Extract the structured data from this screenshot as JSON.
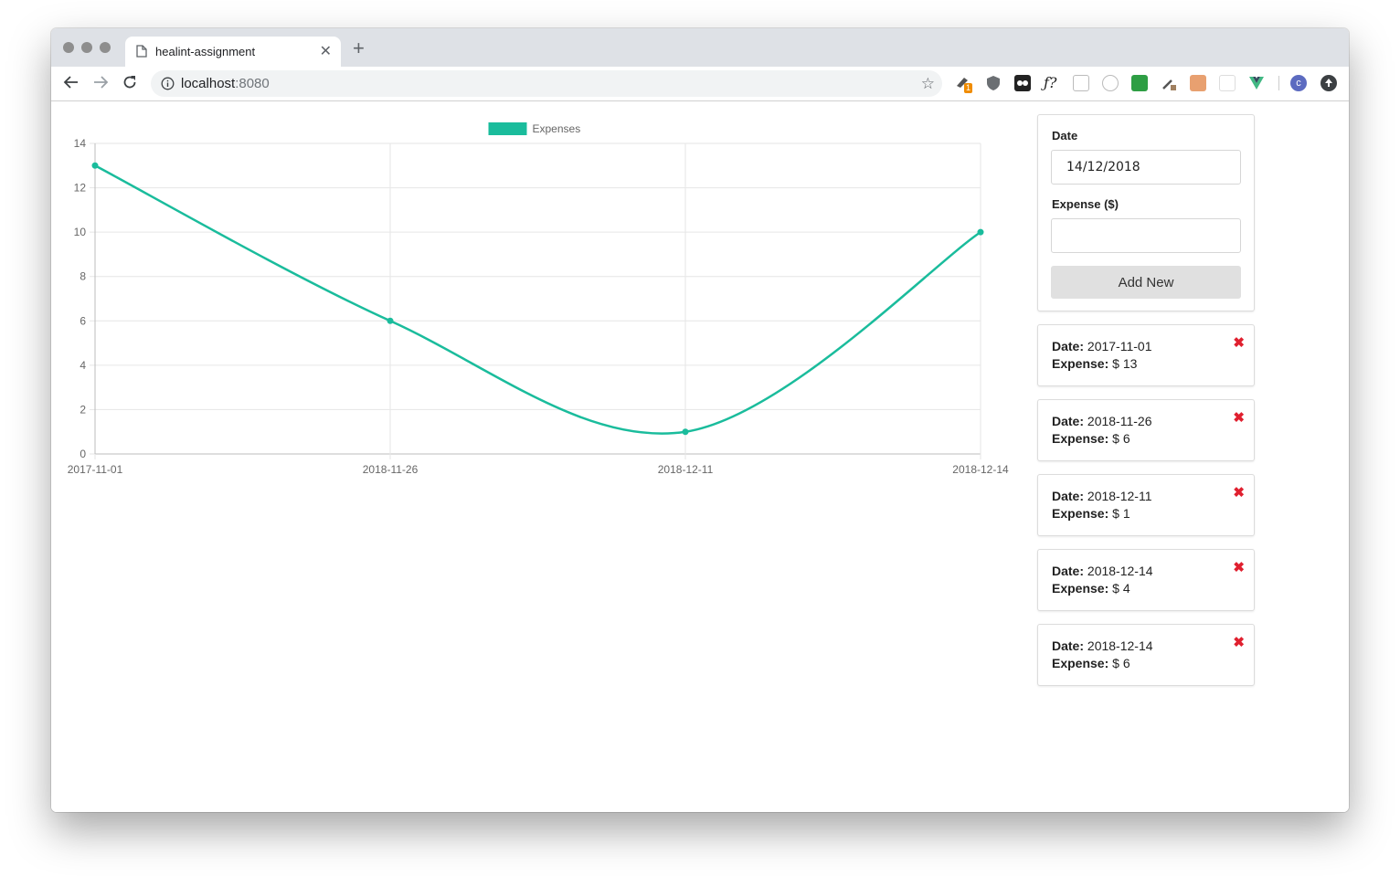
{
  "browser": {
    "tab_title": "healint-assignment",
    "url_host": "localhost",
    "url_port": ":8080",
    "extension_badge": "1",
    "profile_initial": "c"
  },
  "chart_data": {
    "type": "line",
    "categories": [
      "2017-11-01",
      "2018-11-26",
      "2018-12-11",
      "2018-12-14"
    ],
    "series": [
      {
        "name": "Expenses",
        "values": [
          13,
          6,
          1,
          10
        ],
        "color": "#1abc9c"
      }
    ],
    "ylim": [
      0,
      14
    ],
    "yticks": [
      0,
      2,
      4,
      6,
      8,
      10,
      12,
      14
    ],
    "legend": "top-center",
    "grid": true,
    "smooth": true
  },
  "form": {
    "date_label": "Date",
    "date_value": "14/12/2018",
    "expense_label": "Expense ($)",
    "expense_value": "",
    "add_button": "Add New"
  },
  "entries": [
    {
      "date_label": "Date:",
      "date": "2017-11-01",
      "expense_label": "Expense:",
      "expense": "$ 13"
    },
    {
      "date_label": "Date:",
      "date": "2018-11-26",
      "expense_label": "Expense:",
      "expense": "$ 6"
    },
    {
      "date_label": "Date:",
      "date": "2018-12-11",
      "expense_label": "Expense:",
      "expense": "$ 1"
    },
    {
      "date_label": "Date:",
      "date": "2018-12-14",
      "expense_label": "Expense:",
      "expense": "$ 4"
    },
    {
      "date_label": "Date:",
      "date": "2018-12-14",
      "expense_label": "Expense:",
      "expense": "$ 6"
    }
  ],
  "colors": {
    "accent": "#1abc9c",
    "delete": "#e0202f"
  },
  "icons": {
    "delete": "close-x-icon",
    "back": "back-arrow-icon",
    "forward": "forward-arrow-icon",
    "reload": "reload-icon",
    "bookmark": "star-icon"
  }
}
